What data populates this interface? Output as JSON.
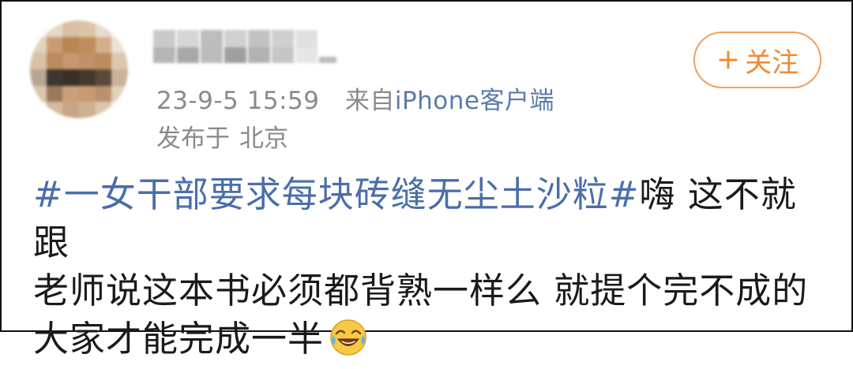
{
  "post": {
    "meta": {
      "time": "23-9-5 15:59",
      "source_prefix": "来自",
      "source": "iPhone客户端"
    },
    "location": {
      "label": "发布于",
      "city": "北京"
    },
    "follow_button": {
      "plus": "+",
      "label": "关注"
    },
    "content": {
      "hashtag": "#一女干部要求每块砖缝无尘土沙粒#",
      "line1_rest": "嗨 这不就跟",
      "line2": "老师说这本书必须都背熟一样么 就提个完不成的",
      "line3": "大家才能完成一半",
      "emoji": "laughing-crying-emoji"
    }
  },
  "colors": {
    "hashtag": "#4a6ea9",
    "source_link": "#5b7ba8",
    "follow_accent": "#f08a30",
    "follow_border": "#f0a060",
    "meta_gray": "#8a8a8a",
    "text": "#1a1a1a"
  }
}
